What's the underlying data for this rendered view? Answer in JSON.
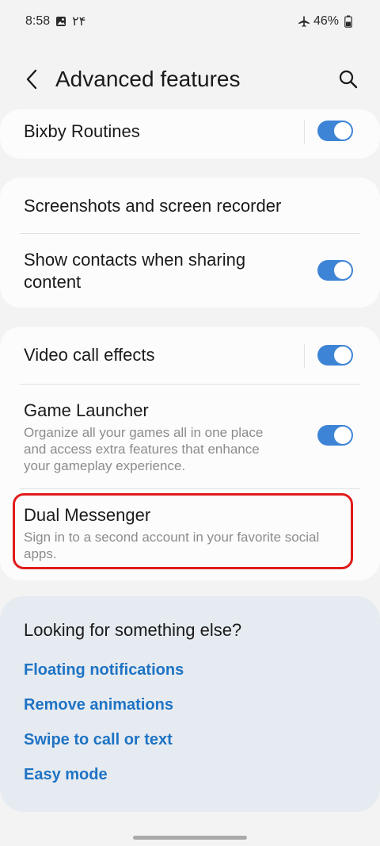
{
  "status_bar": {
    "time": "8:58",
    "extra": "۲۴",
    "battery": "46%"
  },
  "header": {
    "title": "Advanced features"
  },
  "items": {
    "bixby": {
      "title": "Bixby Routines",
      "enabled": true
    },
    "screenshots": {
      "title": "Screenshots and screen recorder"
    },
    "contacts": {
      "title_line1": "Show contacts when sharing",
      "title_line2": "content",
      "enabled": true
    },
    "video": {
      "title": "Video call effects",
      "enabled": true
    },
    "game": {
      "title": "Game Launcher",
      "sub_line1": "Organize all your games all in one place",
      "sub_line2": "and access extra features that enhance",
      "sub_line3": "your gameplay experience.",
      "enabled": true
    },
    "dual": {
      "title": "Dual Messenger",
      "sub_line1": "Sign in to a second account in your favorite social",
      "sub_line2": "apps."
    }
  },
  "suggestions": {
    "title": "Looking for something else?",
    "links": [
      "Floating notifications",
      "Remove animations",
      "Swipe to call or text",
      "Easy mode"
    ]
  },
  "colors": {
    "accent": "#3e84d6",
    "link": "#1e73c4",
    "highlight": "#e01c1c"
  }
}
